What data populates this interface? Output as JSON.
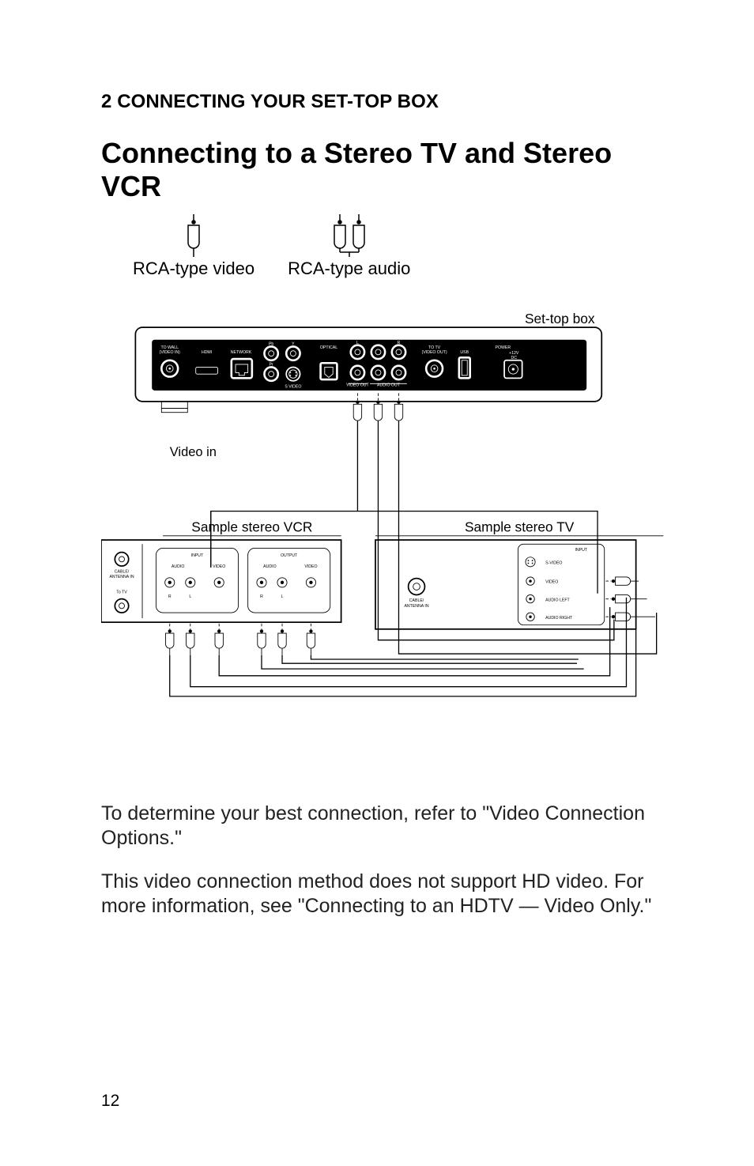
{
  "section": "2 CONNECTING YOUR SET-TOP BOX",
  "title": "Connecting to a Stereo TV and Stereo VCR",
  "cables": {
    "video": "RCA-type video",
    "audio": "RCA-type audio"
  },
  "diagram": {
    "stb_label": "Set-top box",
    "video_in": "Video in",
    "vcr_label": "Sample stereo VCR",
    "tv_label": "Sample stereo TV",
    "stb_ports": {
      "to_wall": "TO WALL\n(VIDEO IN)",
      "hdmi": "HDMI",
      "network": "NETWORK",
      "pb": "Pb",
      "y": "Y",
      "pr": "Pr",
      "svideo": "S VIDEO",
      "optical": "OPTICAL",
      "l": "L",
      "r": "R",
      "video_out": "VIDEO OUT",
      "audio_out": "AUDIO OUT",
      "to_tv": "TO TV\n(VIDEO OUT)",
      "usb": "USB",
      "power": "POWER",
      "volts": "+12V\nDC"
    },
    "vcr_ports": {
      "cable_in": "CABLE/\nANTENNA IN",
      "to_tv": "To TV",
      "input": "INPUT",
      "output": "OUTPUT",
      "audio": "AUDIO",
      "video": "VIDEO",
      "r": "R",
      "l": "L"
    },
    "tv_ports": {
      "cable_in": "CABLE/\nANTENNA IN",
      "input": "INPUT",
      "svideo": "S-VIDEO",
      "video": "VIDEO",
      "audio_l": "AUDIO LEFT",
      "audio_r": "AUDIO RIGHT"
    }
  },
  "para1": "To determine your best connection, refer to \"Video Connection Options.\"",
  "para2": "This video connection method does not support HD video. For more information, see \"Connecting to an HDTV — Video Only.\"",
  "page": "12"
}
